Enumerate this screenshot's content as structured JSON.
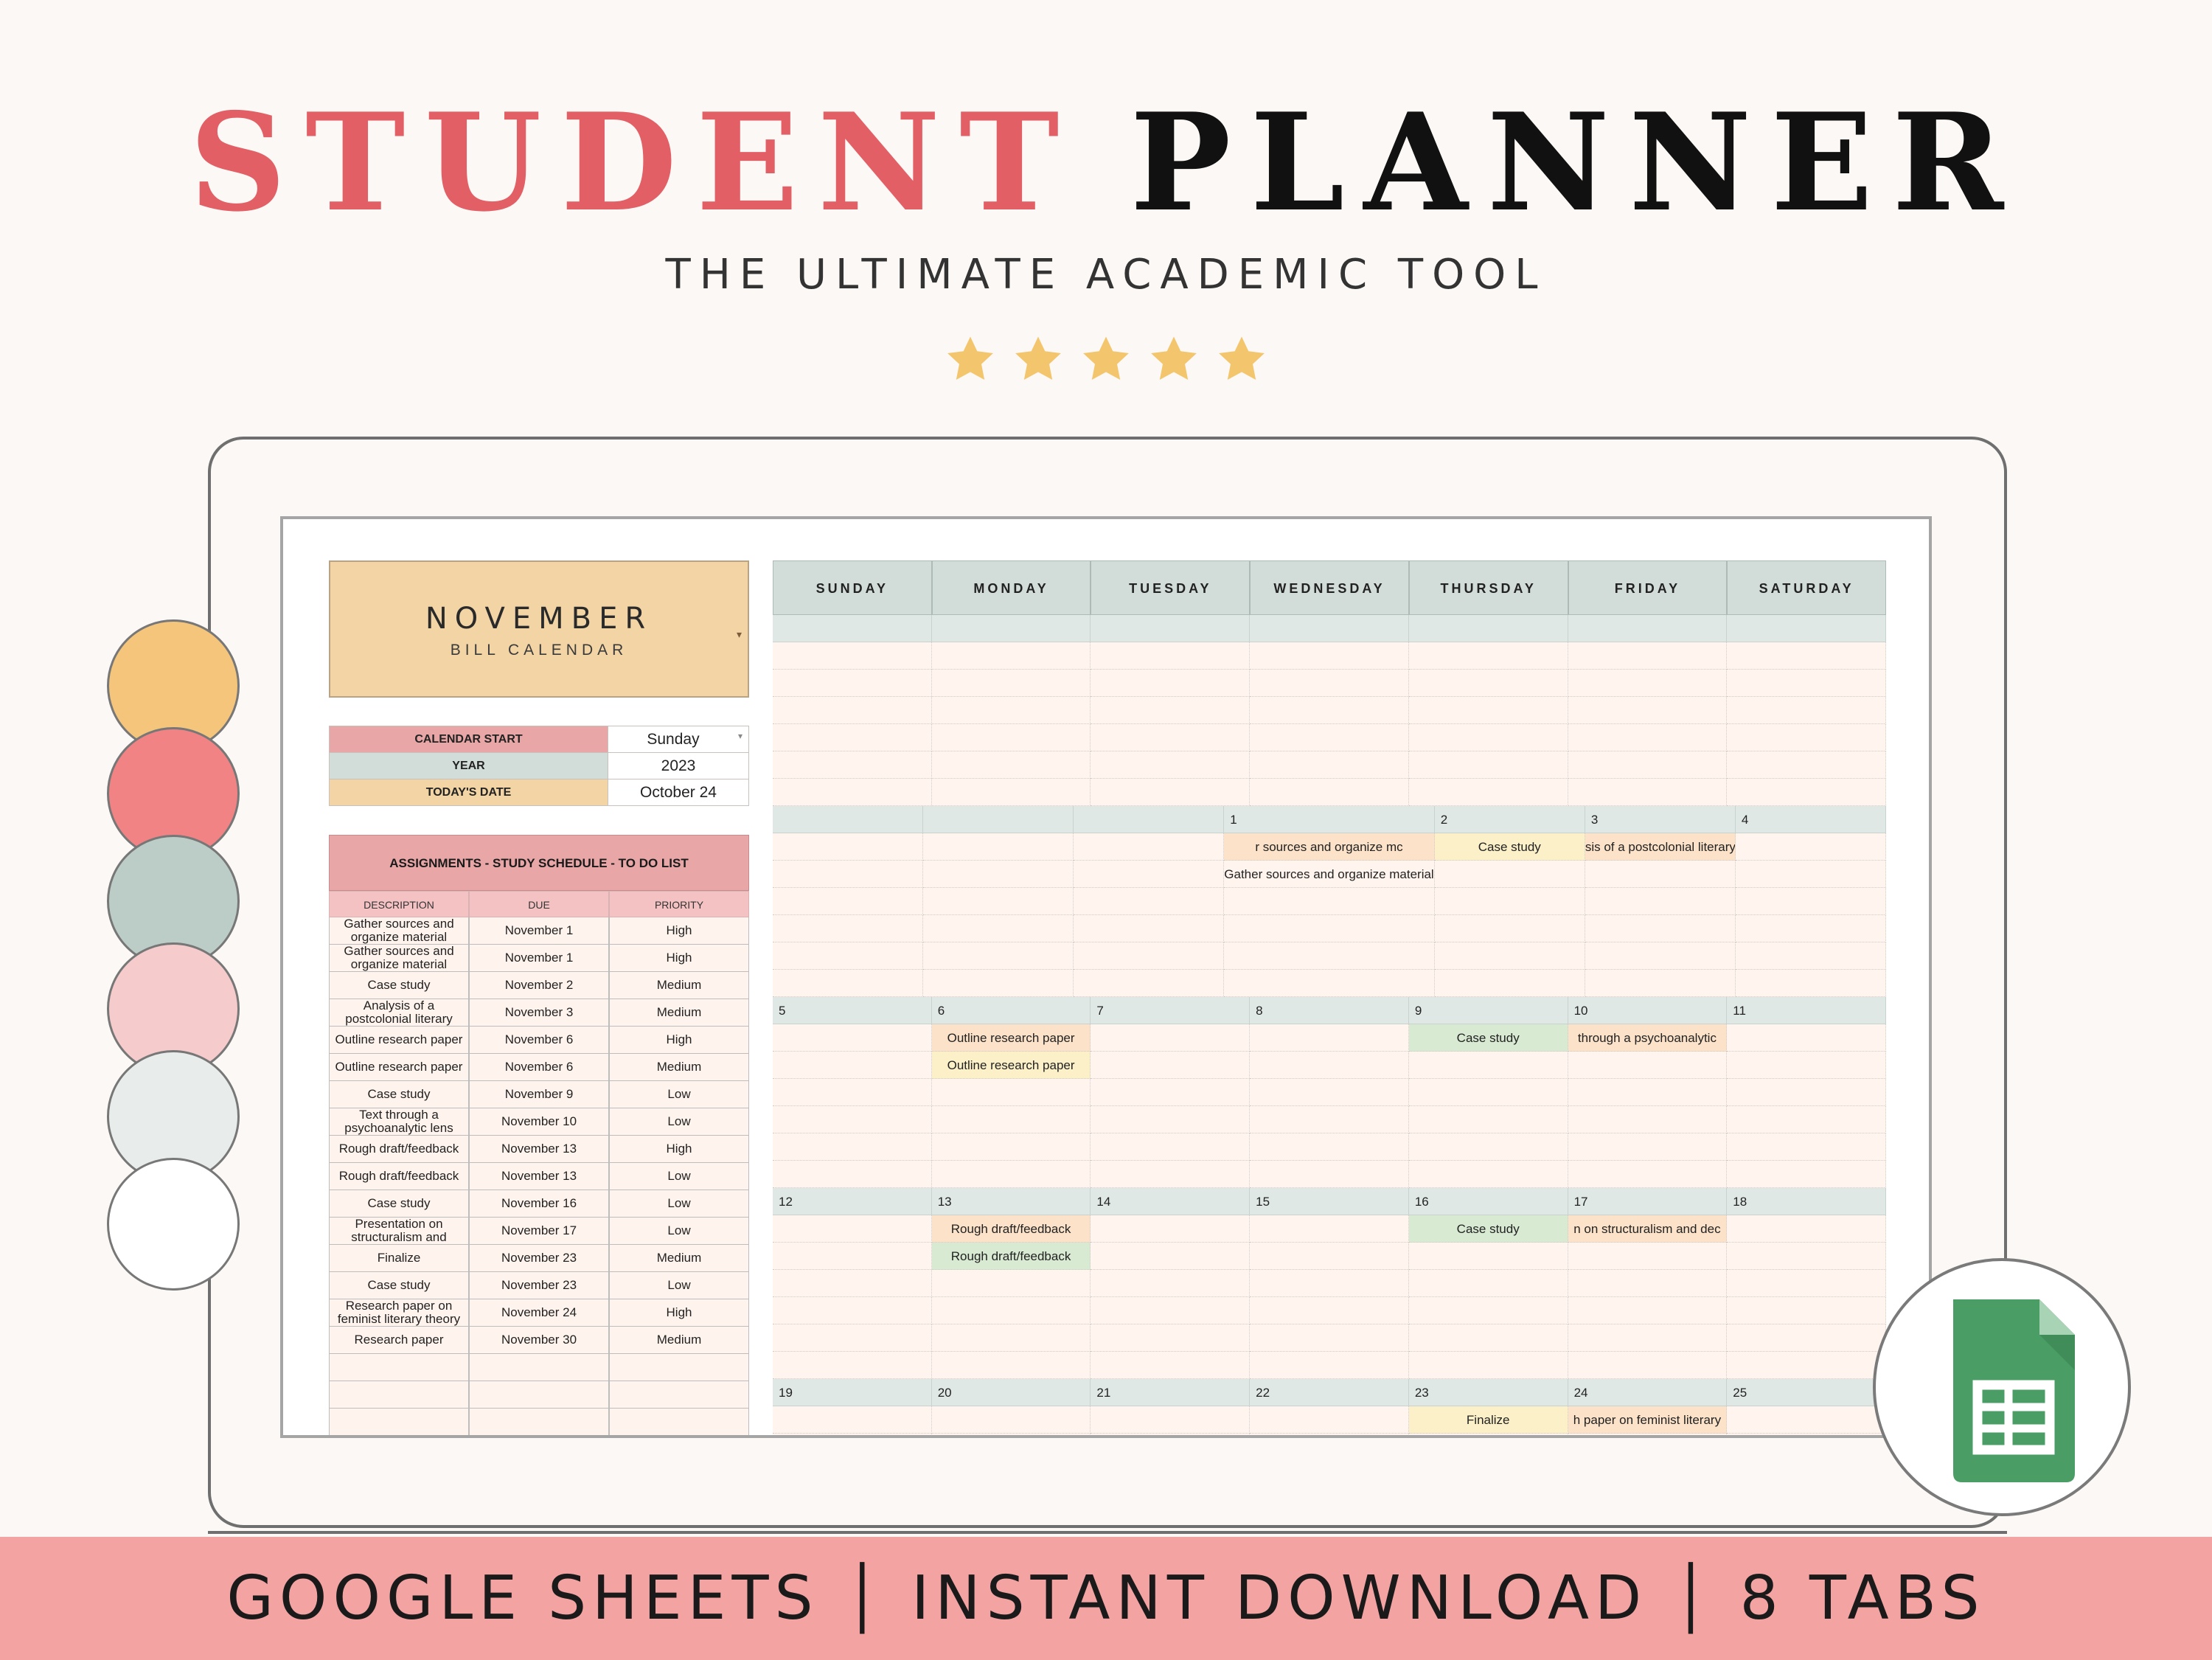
{
  "header": {
    "title_part1": "STUDENT",
    "title_part2": "PLANNER",
    "subtitle": "THE ULTIMATE ACADEMIC TOOL",
    "star_count": 5,
    "star_color": "#f3c66d",
    "title_accent_color": "#e25f65"
  },
  "swatches": [
    "#f4c57b",
    "#f28385",
    "#bccdc7",
    "#f5cbcc",
    "#e8eceb",
    "#ffffff"
  ],
  "month_card": {
    "month": "NOVEMBER",
    "subtitle": "BILL CALENDAR"
  },
  "info": [
    {
      "label": "CALENDAR START",
      "value": "Sunday",
      "color": "#e8a6a6"
    },
    {
      "label": "YEAR",
      "value": "2023",
      "color": "#d2ddd9"
    },
    {
      "label": "TODAY'S DATE",
      "value": "October 24",
      "color": "#f3d4a4"
    }
  ],
  "tasks": {
    "title": "ASSIGNMENTS - STUDY SCHEDULE - TO DO LIST",
    "columns": [
      "DESCRIPTION",
      "DUE",
      "PRIORITY"
    ],
    "rows": [
      {
        "description": "Gather sources and organize material",
        "due": "November 1",
        "priority": "High"
      },
      {
        "description": "Gather sources and organize material",
        "due": "November 1",
        "priority": "High"
      },
      {
        "description": "Case study",
        "due": "November 2",
        "priority": "Medium"
      },
      {
        "description": "Analysis of a postcolonial literary",
        "due": "November 3",
        "priority": "Medium"
      },
      {
        "description": "Outline research paper",
        "due": "November 6",
        "priority": "High"
      },
      {
        "description": "Outline research paper",
        "due": "November 6",
        "priority": "Medium"
      },
      {
        "description": "Case study",
        "due": "November 9",
        "priority": "Low"
      },
      {
        "description": "Text through a psychoanalytic lens",
        "due": "November 10",
        "priority": "Low"
      },
      {
        "description": "Rough draft/feedback",
        "due": "November 13",
        "priority": "High"
      },
      {
        "description": "Rough draft/feedback",
        "due": "November 13",
        "priority": "Low"
      },
      {
        "description": "Case study",
        "due": "November 16",
        "priority": "Low"
      },
      {
        "description": "Presentation on structuralism and",
        "due": "November 17",
        "priority": "Low"
      },
      {
        "description": "Finalize",
        "due": "November 23",
        "priority": "Medium"
      },
      {
        "description": "Case study",
        "due": "November 23",
        "priority": "Low"
      },
      {
        "description": "Research paper on feminist literary theory",
        "due": "November 24",
        "priority": "High"
      },
      {
        "description": "Research paper",
        "due": "November 30",
        "priority": "Medium"
      },
      {
        "description": "",
        "due": "",
        "priority": ""
      },
      {
        "description": "",
        "due": "",
        "priority": ""
      },
      {
        "description": "",
        "due": "",
        "priority": ""
      }
    ]
  },
  "calendar": {
    "days": [
      "SUNDAY",
      "MONDAY",
      "TUESDAY",
      "WEDNESDAY",
      "THURSDAY",
      "FRIDAY",
      "SATURDAY"
    ],
    "weeks": [
      {
        "dates": [
          "",
          "",
          "",
          "",
          "",
          "",
          ""
        ],
        "events": []
      },
      {
        "dates": [
          "",
          "",
          "",
          "1",
          "2",
          "3",
          "4"
        ],
        "events": [
          {
            "col": 3,
            "row": 0,
            "text": "r sources and organize mc",
            "color": "peach"
          },
          {
            "col": 4,
            "row": 0,
            "text": "Case study",
            "color": "yellow"
          },
          {
            "col": 5,
            "row": 0,
            "text": "sis of a postcolonial literary",
            "color": "peach"
          },
          {
            "col": 3,
            "row": 1,
            "text": "Gather sources and organize material",
            "color": "none",
            "wide": true
          }
        ]
      },
      {
        "dates": [
          "5",
          "6",
          "7",
          "8",
          "9",
          "10",
          "11"
        ],
        "events": [
          {
            "col": 1,
            "row": 0,
            "text": "Outline research paper",
            "color": "peach"
          },
          {
            "col": 4,
            "row": 0,
            "text": "Case study",
            "color": "green"
          },
          {
            "col": 5,
            "row": 0,
            "text": "through a psychoanalytic",
            "color": "peach"
          },
          {
            "col": 1,
            "row": 1,
            "text": "Outline research paper",
            "color": "yellow"
          }
        ]
      },
      {
        "dates": [
          "12",
          "13",
          "14",
          "15",
          "16",
          "17",
          "18"
        ],
        "events": [
          {
            "col": 1,
            "row": 0,
            "text": "Rough draft/feedback",
            "color": "peach"
          },
          {
            "col": 4,
            "row": 0,
            "text": "Case study",
            "color": "green"
          },
          {
            "col": 5,
            "row": 0,
            "text": "n on structuralism and dec",
            "color": "peach"
          },
          {
            "col": 1,
            "row": 1,
            "text": "Rough draft/feedback",
            "color": "green"
          }
        ]
      },
      {
        "dates": [
          "19",
          "20",
          "21",
          "22",
          "23",
          "24",
          "25"
        ],
        "events": [
          {
            "col": 4,
            "row": 0,
            "text": "Finalize",
            "color": "yellow"
          },
          {
            "col": 5,
            "row": 0,
            "text": "h paper on feminist literary",
            "color": "peach"
          }
        ]
      }
    ]
  },
  "footer": {
    "text": "GOOGLE SHEETS │ INSTANT DOWNLOAD │ 8 TABS"
  },
  "sheets_icon": {
    "name": "google-sheets-icon",
    "color": "#4a9d64"
  }
}
